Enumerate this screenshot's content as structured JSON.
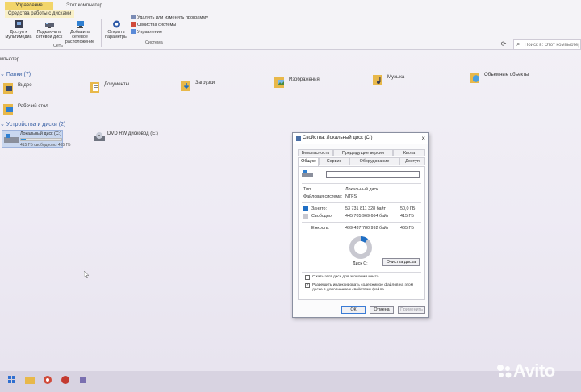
{
  "ribbon": {
    "context_tab": "Управление",
    "context_tab_title": "Этот компьютер",
    "active_tab": "Средства работы с дисками",
    "buttons": [
      {
        "label": "Доступ к мультимедиа"
      },
      {
        "label": "Подключить сетевой диск"
      },
      {
        "label": "Добавить сетевое расположение"
      },
      {
        "label": "Открыть параметры"
      }
    ],
    "group_network": "Сеть",
    "group_system": "Система",
    "small_commands": [
      {
        "label": "Удалить или изменить программу"
      },
      {
        "label": "Свойства системы"
      },
      {
        "label": "Управление"
      }
    ]
  },
  "search": {
    "placeholder": "Поиск в: Этот компьютер"
  },
  "breadcrumb": "мпьютер",
  "folders_section": {
    "title": "Папки (7)",
    "items": [
      {
        "label": "Видео"
      },
      {
        "label": "Документы"
      },
      {
        "label": "Загрузки"
      },
      {
        "label": "Изображения"
      },
      {
        "label": "Музыка"
      },
      {
        "label": "Объемные объекты"
      },
      {
        "label": "Рабочий стол"
      }
    ]
  },
  "drives_section": {
    "title": "Устройства и диски (2)",
    "drive_c": {
      "name": "Локальный диск (C:)",
      "free": "415 ГБ свободно из 465 ГБ",
      "used_fraction": 0.11
    },
    "dvd": {
      "name": "DVD RW дисковод (E:)"
    }
  },
  "dialog": {
    "title": "Свойства: Локальный диск (C:)",
    "tabs_top": [
      "Безопасность",
      "Предыдущие версии",
      "Квота"
    ],
    "tabs_bottom": [
      "Общие",
      "Сервис",
      "Оборудование",
      "Доступ"
    ],
    "active_tab": "Общие",
    "type_label": "Тип:",
    "type_value": "Локальный диск",
    "fs_label": "Файловая система:",
    "fs_value": "NTFS",
    "used_label": "Занято:",
    "used_bytes": "53 731 811 328 байт",
    "used_gb": "50,0 ГБ",
    "free_label": "Свободно:",
    "free_bytes": "445 705 969 664 байт",
    "free_gb": "415 ГБ",
    "capacity_label": "Емкость:",
    "capacity_bytes": "499 437 780 992 байт",
    "capacity_gb": "465 ГБ",
    "disk_label": "Диск C:",
    "cleanup_button": "Очистка диска",
    "compress_label": "Сжать этот диск для экономии места",
    "index_label": "Разрешить индексировать содержимое файлов на этом диске в дополнение к свойствам файла",
    "index_checked": true,
    "ok_button": "ОК",
    "cancel_button": "Отмена",
    "apply_button": "Применить",
    "colors": {
      "used": "#1f6fc5",
      "free": "#c8c8d0"
    }
  },
  "watermark": "Avito"
}
